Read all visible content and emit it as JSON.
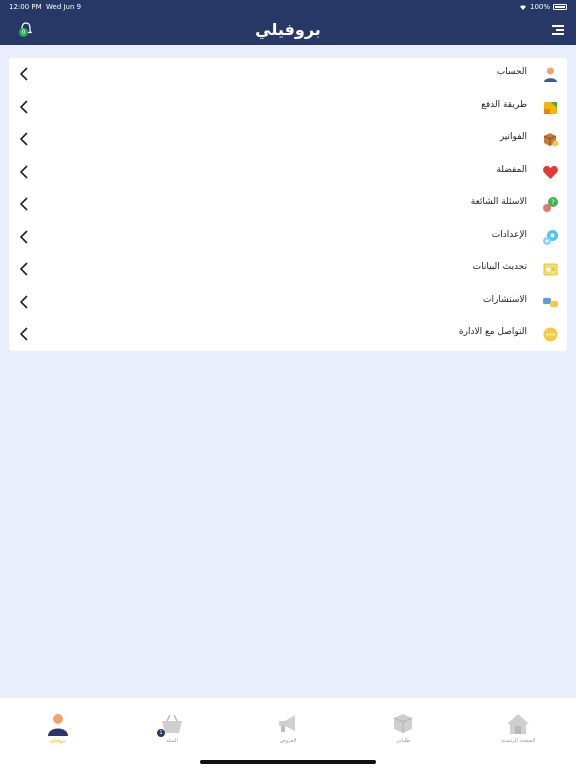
{
  "status": {
    "time": "12:00 PM",
    "date": "Wed Jun 9",
    "battery": "100%"
  },
  "header": {
    "title": "بروفيلي",
    "notification_count": "0"
  },
  "menu": [
    {
      "label": "الحساب",
      "icon": "user-icon"
    },
    {
      "label": "طريقة الدفع",
      "icon": "wallet-icon"
    },
    {
      "label": "الفواتير",
      "icon": "box-icon"
    },
    {
      "label": "المفضلة",
      "icon": "heart-icon"
    },
    {
      "label": "الاسئلة الشائعة",
      "icon": "faq-icon"
    },
    {
      "label": "الإعدادات",
      "icon": "settings-icon"
    },
    {
      "label": "تحديث البيانات",
      "icon": "update-data-icon"
    },
    {
      "label": "الاستشارات",
      "icon": "consultations-icon"
    },
    {
      "label": "التواصل مع الادارة",
      "icon": "chat-icon"
    }
  ],
  "tabbar": {
    "profile": "بروفيلي",
    "cart": "السلة",
    "cart_count": "1",
    "offers": "العروض",
    "orders": "طلباتي",
    "home": "الصفحة الرئيسية"
  },
  "colors": {
    "header": "#283866",
    "background": "#e8eefb",
    "active_tab": "#f0b400",
    "badge": "#22b14c"
  }
}
